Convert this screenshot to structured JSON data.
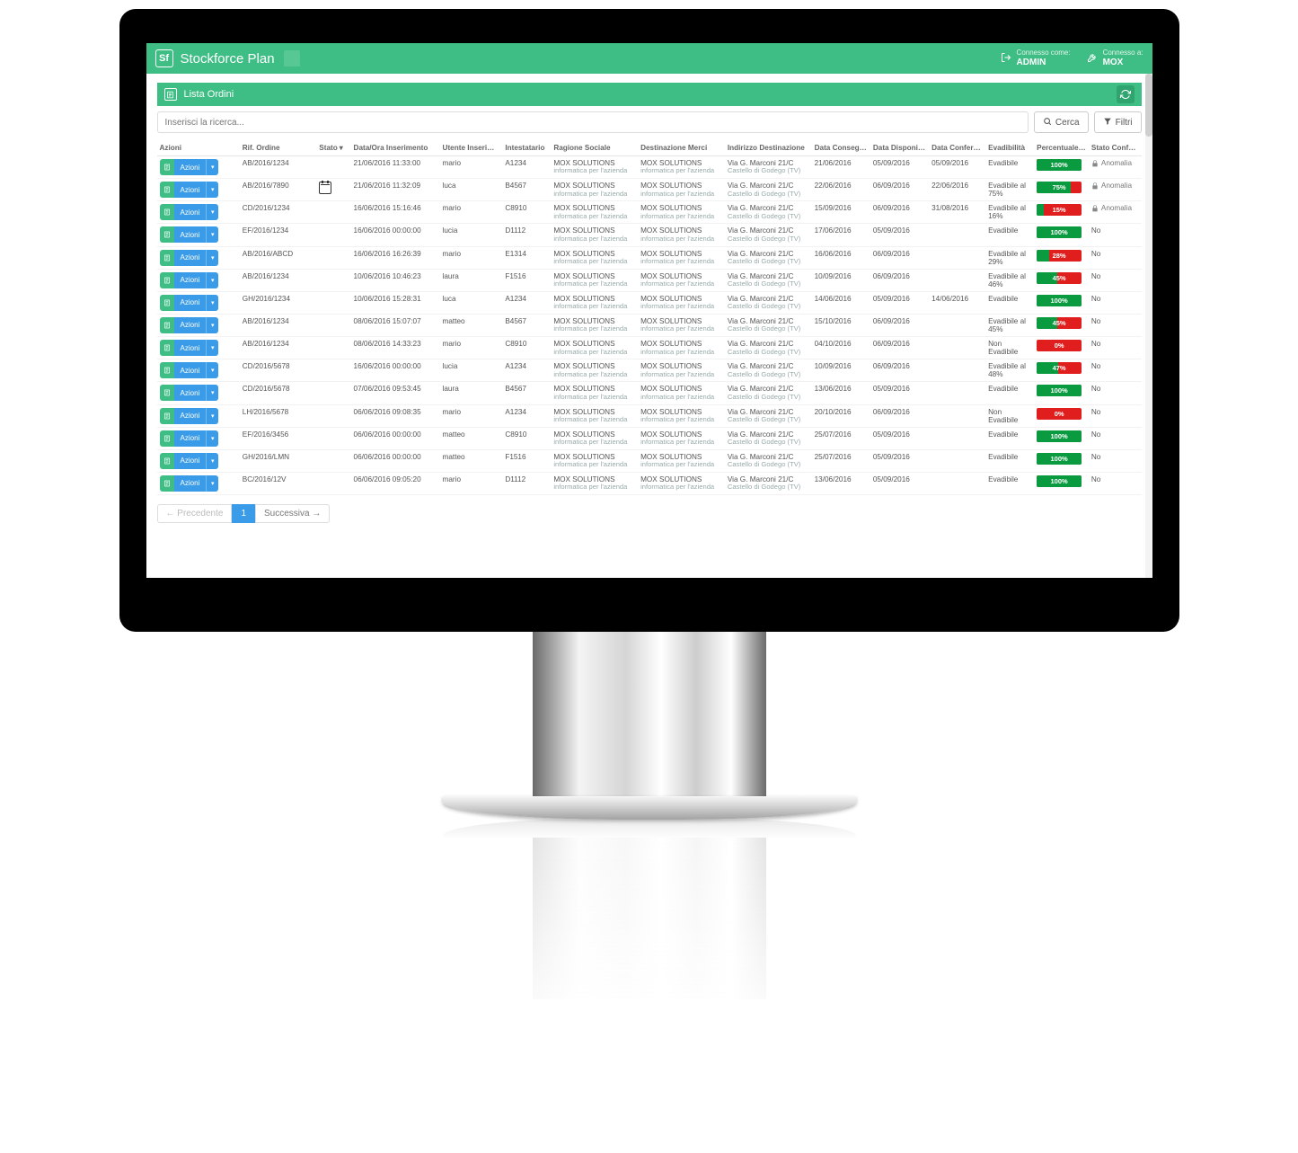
{
  "brand": {
    "logo_text": "Sf",
    "name": "Stockforce Plan"
  },
  "topbar": {
    "login_label": "Connesso come:",
    "login_value": "ADMIN",
    "company_label": "Connesso a:",
    "company_value": "MOX"
  },
  "panel": {
    "title": "Lista Ordini"
  },
  "search": {
    "placeholder": "Inserisci la ricerca...",
    "search_btn": "Cerca",
    "filter_btn": "Filtri"
  },
  "columns": {
    "azioni": "Azioni",
    "rif_ordine": "Rif. Ordine",
    "stato": "Stato",
    "dataora": "Data/Ora Inserimento",
    "utente": "Utente Inserimento",
    "intestatario": "Intestatario",
    "ragione": "Ragione Sociale",
    "destinazione": "Destinazione Merci",
    "indirizzo": "Indirizzo Destinazione",
    "consegna": "Data Consegna Rich.",
    "disponibilita": "Data Disponibilità",
    "confermata": "Data Confermata",
    "evadibilita": "Evadibilità",
    "percentuale": "Percentuale Evadibile",
    "stato_conferma": "Stato Conferma"
  },
  "shared": {
    "azioni_label": "Azioni",
    "ragione_l1": "MOX SOLUTIONS",
    "ragione_l2": "informatica per l'azienda",
    "indirizzo_l1": "Via G. Marconi 21/C",
    "indirizzo_l2": "Castello di Godego (TV)",
    "anomalia": "Anomalia",
    "no": "No"
  },
  "rows": [
    {
      "rif": "AB/2016/1234",
      "stato_icon": "",
      "dataora": "21/06/2016 11:33:00",
      "utente": "mario",
      "intest": "A1234",
      "consegna": "21/06/2016",
      "disp": "05/09/2016",
      "conf": "05/09/2016",
      "evad": "Evadibile",
      "pct": 100,
      "conf_stato": "anomalia"
    },
    {
      "rif": "AB/2016/7890",
      "stato_icon": "cal",
      "dataora": "21/06/2016 11:32:09",
      "utente": "luca",
      "intest": "B4567",
      "consegna": "22/06/2016",
      "disp": "06/09/2016",
      "conf": "22/06/2016",
      "evad": "Evadibile al 75%",
      "pct": 75,
      "conf_stato": "anomalia"
    },
    {
      "rif": "CD/2016/1234",
      "stato_icon": "",
      "dataora": "16/06/2016 15:16:46",
      "utente": "mario",
      "intest": "C8910",
      "consegna": "15/09/2016",
      "disp": "06/09/2016",
      "conf": "31/08/2016",
      "evad": "Evadibile al 16%",
      "pct": 15,
      "conf_stato": "anomalia"
    },
    {
      "rif": "EF/2016/1234",
      "stato_icon": "",
      "dataora": "16/06/2016 00:00:00",
      "utente": "lucia",
      "intest": "D1112",
      "consegna": "17/06/2016",
      "disp": "05/09/2016",
      "conf": "",
      "evad": "Evadibile",
      "pct": 100,
      "conf_stato": "no"
    },
    {
      "rif": "AB/2016/ABCD",
      "stato_icon": "",
      "dataora": "16/06/2016 16:26:39",
      "utente": "mario",
      "intest": "E1314",
      "consegna": "16/06/2016",
      "disp": "06/09/2016",
      "conf": "",
      "evad": "Evadibile al 29%",
      "pct": 28,
      "conf_stato": "no"
    },
    {
      "rif": "AB/2016/1234",
      "stato_icon": "",
      "dataora": "10/06/2016 10:46:23",
      "utente": "laura",
      "intest": "F1516",
      "consegna": "10/09/2016",
      "disp": "06/09/2016",
      "conf": "",
      "evad": "Evadibile al 46%",
      "pct": 45,
      "conf_stato": "no"
    },
    {
      "rif": "GH/2016/1234",
      "stato_icon": "",
      "dataora": "10/06/2016 15:28:31",
      "utente": "luca",
      "intest": "A1234",
      "consegna": "14/06/2016",
      "disp": "05/09/2016",
      "conf": "14/06/2016",
      "evad": "Evadibile",
      "pct": 100,
      "conf_stato": "no"
    },
    {
      "rif": "AB/2016/1234",
      "stato_icon": "",
      "dataora": "08/06/2016 15:07:07",
      "utente": "matteo",
      "intest": "B4567",
      "consegna": "15/10/2016",
      "disp": "06/09/2016",
      "conf": "",
      "evad": "Evadibile al 45%",
      "pct": 45,
      "conf_stato": "no"
    },
    {
      "rif": "AB/2016/1234",
      "stato_icon": "",
      "dataora": "08/06/2016 14:33:23",
      "utente": "mario",
      "intest": "C8910",
      "consegna": "04/10/2016",
      "disp": "06/09/2016",
      "conf": "",
      "evad": "Non Evadibile",
      "pct": 0,
      "conf_stato": "no"
    },
    {
      "rif": "CD/2016/5678",
      "stato_icon": "",
      "dataora": "16/06/2016 00:00:00",
      "utente": "lucia",
      "intest": "A1234",
      "consegna": "10/09/2016",
      "disp": "06/09/2016",
      "conf": "",
      "evad": "Evadibile al 48%",
      "pct": 47,
      "conf_stato": "no"
    },
    {
      "rif": "CD/2016/5678",
      "stato_icon": "",
      "dataora": "07/06/2016 09:53:45",
      "utente": "laura",
      "intest": "B4567",
      "consegna": "13/06/2016",
      "disp": "05/09/2016",
      "conf": "",
      "evad": "Evadibile",
      "pct": 100,
      "conf_stato": "no"
    },
    {
      "rif": "LH/2016/5678",
      "stato_icon": "",
      "dataora": "06/06/2016 09:08:35",
      "utente": "mario",
      "intest": "A1234",
      "consegna": "20/10/2016",
      "disp": "06/09/2016",
      "conf": "",
      "evad": "Non Evadibile",
      "pct": 0,
      "conf_stato": "no"
    },
    {
      "rif": "EF/2016/3456",
      "stato_icon": "",
      "dataora": "06/06/2016 00:00:00",
      "utente": "matteo",
      "intest": "C8910",
      "consegna": "25/07/2016",
      "disp": "05/09/2016",
      "conf": "",
      "evad": "Evadibile",
      "pct": 100,
      "conf_stato": "no"
    },
    {
      "rif": "GH/2016/LMN",
      "stato_icon": "",
      "dataora": "06/06/2016 00:00:00",
      "utente": "matteo",
      "intest": "F1516",
      "consegna": "25/07/2016",
      "disp": "05/09/2016",
      "conf": "",
      "evad": "Evadibile",
      "pct": 100,
      "conf_stato": "no"
    },
    {
      "rif": "BC/2016/12V",
      "stato_icon": "",
      "dataora": "06/06/2016 09:05:20",
      "utente": "mario",
      "intest": "D1112",
      "consegna": "13/06/2016",
      "disp": "05/09/2016",
      "conf": "",
      "evad": "Evadibile",
      "pct": 100,
      "conf_stato": "no"
    }
  ],
  "pager": {
    "prev": "← Precedente",
    "page1": "1",
    "next": "Successiva →"
  }
}
